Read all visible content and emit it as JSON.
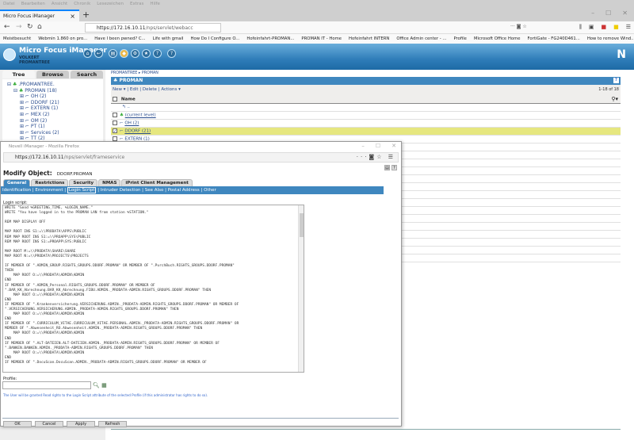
{
  "browser": {
    "menu": [
      "Datei",
      "Bearbeiten",
      "Ansicht",
      "Chronik",
      "Lesezeichen",
      "Extras",
      "Hilfe"
    ],
    "tab_title": "Micro Focus iManager",
    "url_host": "https://172.16.10.11",
    "url_path": "/nps/servlet/webacc",
    "bookmarks": [
      "Meistbesucht",
      "Webmin 1.860 on pro...",
      "Have I been pwned? C...",
      "Life with gmail",
      "How Do I Configure O...",
      "Hofeinfahrt-PROMAN...",
      "PROMAN IT - Home",
      "Hofeinfahrt INTERN",
      "Office Admin center - ...",
      "Profile",
      "Microsoft Office Home",
      "FortiGate - FG240D461...",
      "How to remove Wind..."
    ]
  },
  "imanager": {
    "title": "Micro Focus iManager",
    "user": "VOLKERT",
    "tree": "PROMANTREE",
    "left_tabs": [
      "Tree",
      "Browse",
      "Search"
    ],
    "tree_root": ".PROMANTREE.",
    "tree_items": [
      "PROMAN (18)",
      "OH (2)",
      "DDORF (21)",
      "EXTERN (1)",
      "MEX (2)",
      "OM (2)",
      "PT (1)",
      "Services (2)",
      "TT (2)"
    ],
    "breadcrumb": [
      "PROMANTREE",
      "PROMAN"
    ],
    "container": "PROMAN",
    "actions": {
      "new": "New",
      "edit": "Edit",
      "delete": "Delete",
      "actions": "Actions"
    },
    "count": "1-18 of 18",
    "name_header": "Name",
    "up": "..",
    "rows": [
      "(current level)",
      "OH (2)",
      "DDORF (21)",
      "EXTERN (1)"
    ],
    "selected_row": "DDORF (21)"
  },
  "popup": {
    "title": "Novell iManager - Mozilla Firefox",
    "url_host": "https://172.16.10.11",
    "url_path": "/nps/servlet/frameservice",
    "heading": "Modify Object:",
    "object": "DDORF.PROMAN",
    "tabs": [
      "General",
      "Restrictions",
      "Security",
      "NMAS",
      "iPrint Client Management"
    ],
    "subnav": [
      "Identification",
      "Environment",
      "Login Script",
      "Intruder Detection",
      "See Also",
      "Postal Address",
      "Other"
    ],
    "active_subnav": "Login Script",
    "login_label": "Login script:",
    "script": "WRITE \"Good %GREETING_TIME, %LOGIN_NAME.\"\nWRITE \"You have logged in to the PROMAN LAN from station %STATION.\"\n\nREM MAP DISPLAY OFF\n\nMAP ROOT INS S1:=\\\\PRODATA\\APPS\\PUBLIC\nREM MAP ROOT INS S1:=\\\\PROAPP\\SYS\\PUBLIC\nREM MAP ROOT INS S1:=PROAPP\\SYS:PUBLIC\n\nMAP ROOT M:=\\\\PRODATA\\SHARE\\SHARE\nMAP ROOT N:=\\\\PRODATA\\PROJECTS\\PROJECTS\n\nIF MEMBER OF \".ADMIN_GROUP.RIGHTS_GROUPS.DDORF.PROMAN\" OR MEMBER OF \".PurchBuch.RIGHTS_GROUPS.DDORF.PROMAN\"\nTHEN\n    MAP ROOT O:=\\\\PRODATA\\ADMIN\\ADMIN\nEND\nIF MEMBER OF \".ADMIN_Personal.RIGHTS_GROUPS.DDORF.PROMAN\" OR MEMBER OF\n\".BAR_KK_Abrechnung.BAR_KK_Abrechnung.FIBU.ADMIN._PRODATA-ADMIN.RIGHTS_GROUPS.DDORF.PROMAN\" THEN\n    MAP ROOT O:=\\\\PRODATA\\ADMIN\\ADMIN\nEND\nIF MEMBER OF \".Krankenversicherung.VERSICHERUNG.ADMIN._PRODATA-ADMIN.RIGHTS_GROUPS.DDORF.PROMAN\" OR MEMBER OF\n\".VERSICHERUNG.VERSICHERUNG.ADMIN._PRODATA-ADMIN.RIGHTS_GROUPS.DDORF.PROMAN\" THEN\n    MAP ROOT O:=\\\\PRODATA\\ADMIN\\ADMIN\nEND\nIF MEMBER OF \".CURRICULUM_VITAE.CURRICULUM_VITAE.PERSONAL.ADMIN._PRODATA-ADMIN.RIGHTS_GROUPS.DDORF.PROMAN\" OR\nMEMBER OF \".Abwesenheit_RO.Abwesenheit.ADMIN._PRODATA-ADMIN.RIGHTS_GROUPS.DDORF.PROMAN\" THEN\n    MAP ROOT O:=\\\\PRODATA\\ADMIN\\ADMIN\nEND\nIF MEMBER OF \".ALT-DATEIEN.ALT-DATEIEN.ADMIN._PRODATA-ADMIN.RIGHTS_GROUPS.DDORF.PROMAN\" OR MEMBER OF\n\".BANKEN.BANKEN.ADMIN._PRODATA-ADMIN.RIGHTS_GROUPS.DDORF.PROMAN\" THEN\n    MAP ROOT O:=\\\\PRODATA\\ADMIN\\ADMIN\nEND\nIF MEMBER OF \".DocuScan.DocuScan.ADMIN._PRODATA-ADMIN.RIGHTS_GROUPS.DDORF.PROMAN\" OR MEMBER OF",
    "profile_label": "Profile:",
    "profile_value": "",
    "hint": "The User will be granted Read rights to the Login Script attribute of the selected Profile (if this administrator has rights to do so).",
    "buttons": {
      "ok": "OK",
      "cancel": "Cancel",
      "apply": "Apply",
      "refresh": "Refresh"
    }
  }
}
